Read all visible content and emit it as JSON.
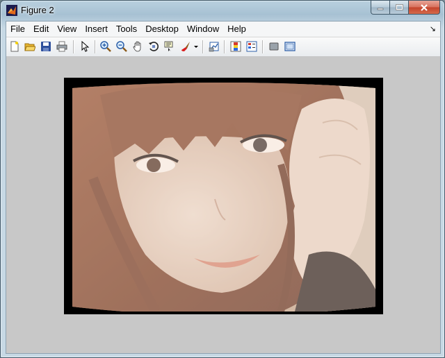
{
  "window": {
    "title": "Figure 2"
  },
  "menu": {
    "items": [
      "File",
      "Edit",
      "View",
      "Insert",
      "Tools",
      "Desktop",
      "Window",
      "Help"
    ],
    "dock_arrow": "↘"
  },
  "toolbar": {
    "buttons": [
      "new-figure-icon",
      "open-file-icon",
      "save-icon",
      "print-icon",
      "edit-plot-arrow-icon",
      "zoom-in-icon",
      "zoom-out-icon",
      "pan-hand-icon",
      "rotate-3d-icon",
      "data-cursor-icon",
      "brush-icon",
      "link-plot-icon",
      "insert-colorbar-icon",
      "insert-legend-icon",
      "hide-plot-tools-icon",
      "show-plot-tools-icon"
    ]
  },
  "colors": {
    "axes_background": "#c8c8c8",
    "image_frame": "#000000",
    "photo_hair": "#8a4a2e",
    "photo_skin": "#e2c7b4"
  }
}
